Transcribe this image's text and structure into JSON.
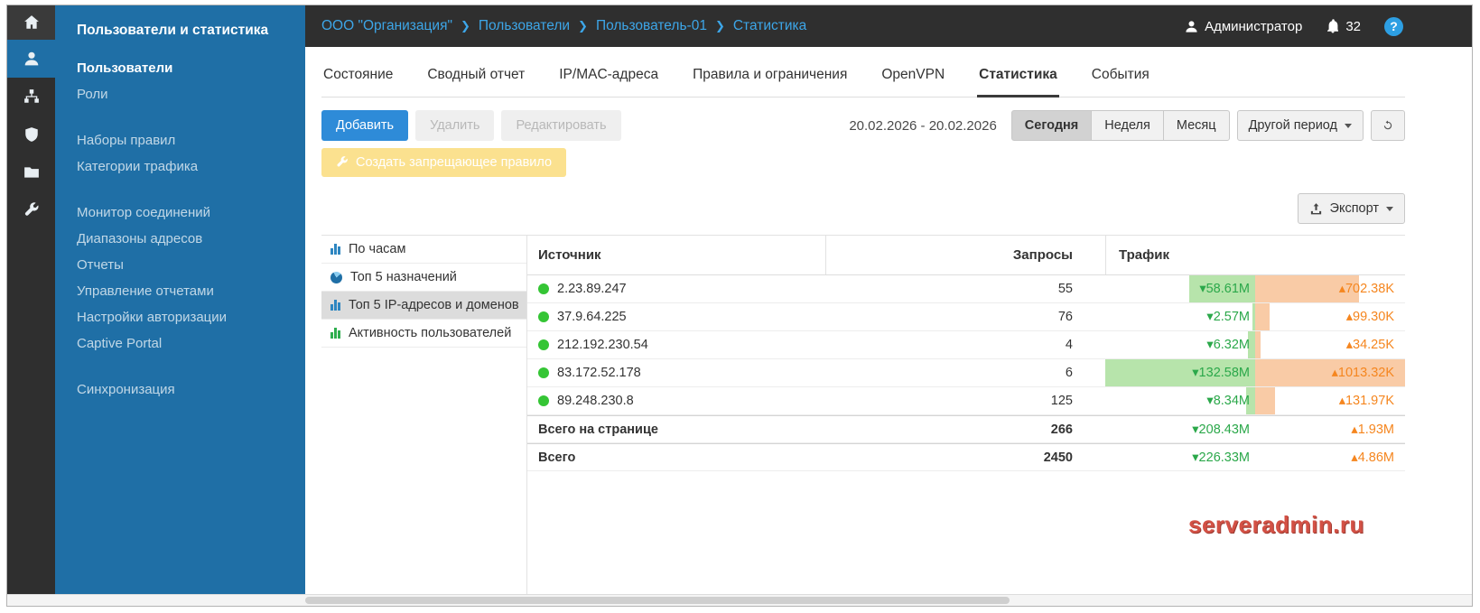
{
  "colors": {
    "sidebar_blue": "#1f6fa6",
    "accent_blue": "#2e8bd8",
    "link_blue": "#3da6e8",
    "green_value": "#2ba84a",
    "orange_value": "#f5861f",
    "bar_green": "#b7e4ab",
    "bar_orange": "#f9cba6",
    "warning_yellow": "#fbe18f",
    "status_dot_green": "#35c535"
  },
  "topbar": {
    "breadcrumbs": [
      "ООО \"Организация\"",
      "Пользователи",
      "Пользователь-01",
      "Статистика"
    ],
    "user": "Администратор",
    "notifications": "32",
    "help": "?"
  },
  "iconbar": {
    "items": [
      {
        "name": "home"
      },
      {
        "name": "users",
        "active": true
      },
      {
        "name": "network"
      },
      {
        "name": "security"
      },
      {
        "name": "folders"
      },
      {
        "name": "tools"
      }
    ]
  },
  "sidebar": {
    "title": "Пользователи и статистика",
    "groups": [
      [
        {
          "label": "Пользователи",
          "active": true
        },
        {
          "label": "Роли"
        }
      ],
      [
        {
          "label": "Наборы правил"
        },
        {
          "label": "Категории трафика"
        }
      ],
      [
        {
          "label": "Монитор соединений"
        },
        {
          "label": "Диапазоны адресов"
        },
        {
          "label": "Отчеты"
        },
        {
          "label": "Управление отчетами"
        },
        {
          "label": "Настройки авторизации"
        },
        {
          "label": "Captive Portal"
        }
      ],
      [
        {
          "label": "Синхронизация"
        }
      ]
    ]
  },
  "tabs": {
    "items": [
      {
        "label": "Состояние"
      },
      {
        "label": "Сводный отчет"
      },
      {
        "label": "IP/MAC-адреса"
      },
      {
        "label": "Правила и ограничения"
      },
      {
        "label": "OpenVPN"
      },
      {
        "label": "Статистика",
        "active": true
      },
      {
        "label": "События"
      }
    ]
  },
  "toolbar": {
    "add": "Добавить",
    "remove": "Удалить",
    "edit": "Редактировать",
    "date_range": "20.02.2026 - 20.02.2026",
    "periods": [
      {
        "label": "Сегодня",
        "active": true
      },
      {
        "label": "Неделя"
      },
      {
        "label": "Месяц"
      }
    ],
    "custom_period": "Другой период",
    "create_block_rule": "Создать запрещающее правило",
    "export": "Экспорт"
  },
  "chart_nav": {
    "items": [
      {
        "label": "По часам"
      },
      {
        "label": "Топ 5 назначений"
      },
      {
        "label": "Топ 5 IP-адресов и доменов",
        "active": true
      },
      {
        "label": "Активность пользователей"
      }
    ]
  },
  "table": {
    "columns": [
      "Источник",
      "Запросы",
      "Трафик"
    ],
    "rows": [
      {
        "source": "2.23.89.247",
        "requests": "55",
        "down_label": "▾58.61M",
        "down_value": 58.61,
        "up_label": "▴702.38K",
        "up_value": 702.38
      },
      {
        "source": "37.9.64.225",
        "requests": "76",
        "down_label": "▾2.57M",
        "down_value": 2.57,
        "up_label": "▴99.30K",
        "up_value": 99.3
      },
      {
        "source": "212.192.230.54",
        "requests": "4",
        "down_label": "▾6.32M",
        "down_value": 6.32,
        "up_label": "▴34.25K",
        "up_value": 34.25
      },
      {
        "source": "83.172.52.178",
        "requests": "6",
        "down_label": "▾132.58M",
        "down_value": 132.58,
        "up_label": "▴1013.32K",
        "up_value": 1013.32
      },
      {
        "source": "89.248.230.8",
        "requests": "125",
        "down_label": "▾8.34M",
        "down_value": 8.34,
        "up_label": "▴131.97K",
        "up_value": 131.97
      }
    ],
    "totals": [
      {
        "label": "Всего на странице",
        "requests": "266",
        "down_label": "▾208.43M",
        "up_label": "▴1.93M"
      },
      {
        "label": "Всего",
        "requests": "2450",
        "down_label": "▾226.33M",
        "up_label": "▴4.86M"
      }
    ]
  },
  "watermark": "serveradmin.ru"
}
